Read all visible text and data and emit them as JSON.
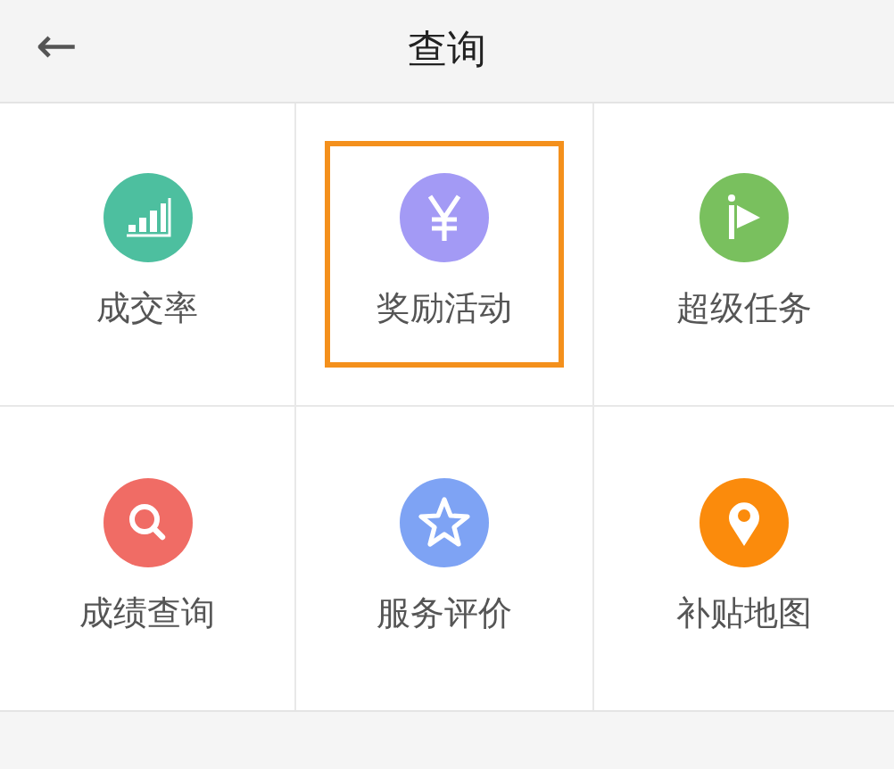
{
  "header": {
    "back": "←",
    "title": "查询"
  },
  "items": [
    {
      "label": "成交率",
      "kind": "chart",
      "color": "#4dbf9f",
      "selected": false
    },
    {
      "label": "奖励活动",
      "kind": "yen",
      "color": "#a39af5",
      "selected": true
    },
    {
      "label": "超级任务",
      "kind": "flag",
      "color": "#79c05e",
      "selected": false
    },
    {
      "label": "成绩查询",
      "kind": "search",
      "color": "#f06c65",
      "selected": false
    },
    {
      "label": "服务评价",
      "kind": "star",
      "color": "#7ea3f4",
      "selected": false
    },
    {
      "label": "补贴地图",
      "kind": "pin",
      "color": "#fb8b0c",
      "selected": false
    }
  ]
}
